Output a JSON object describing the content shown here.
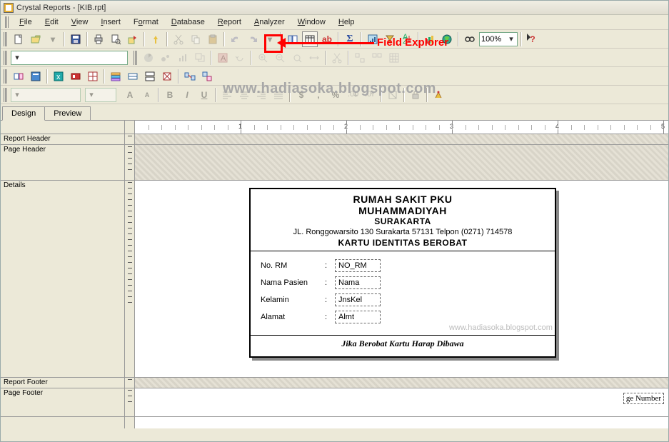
{
  "title": "Crystal Reports - [KIB.rpt]",
  "menu": [
    "File",
    "Edit",
    "View",
    "Insert",
    "Format",
    "Database",
    "Report",
    "Analyzer",
    "Window",
    "Help"
  ],
  "zoom": "100%",
  "annotation": "Field Explorer",
  "watermark": "www.hadiasoka.blogspot.com",
  "watermark2": "www.hadiasoka.blogspot.com",
  "tabs": {
    "design": "Design",
    "preview": "Preview"
  },
  "sections": [
    "Report Header",
    "Page Header",
    "Details",
    "Report Footer",
    "Page Footer"
  ],
  "ruler_numbers": [
    "1",
    "2",
    "3",
    "4",
    "5"
  ],
  "card": {
    "line1": "RUMAH SAKIT PKU",
    "line2": "MUHAMMADIYAH",
    "line3": "SURAKARTA",
    "address": "JL. Ronggowarsito 130 Surakarta 57131 Telpon (0271) 714578",
    "subtitle": "KARTU IDENTITAS BEROBAT",
    "rows": [
      {
        "label": "No. RM",
        "field": "NO_RM"
      },
      {
        "label": "Nama Pasien",
        "field": "Nama"
      },
      {
        "label": "Kelamin",
        "field": "JnsKel"
      },
      {
        "label": "Alamat",
        "field": "Almt"
      }
    ],
    "footer": "Jika Berobat Kartu Harap Dibawa"
  },
  "page_footer_field": "ge Number",
  "format": {
    "bold": "B",
    "italic": "I",
    "underline": "U",
    "currency": "$",
    "comma": ",",
    "percent": "%"
  }
}
